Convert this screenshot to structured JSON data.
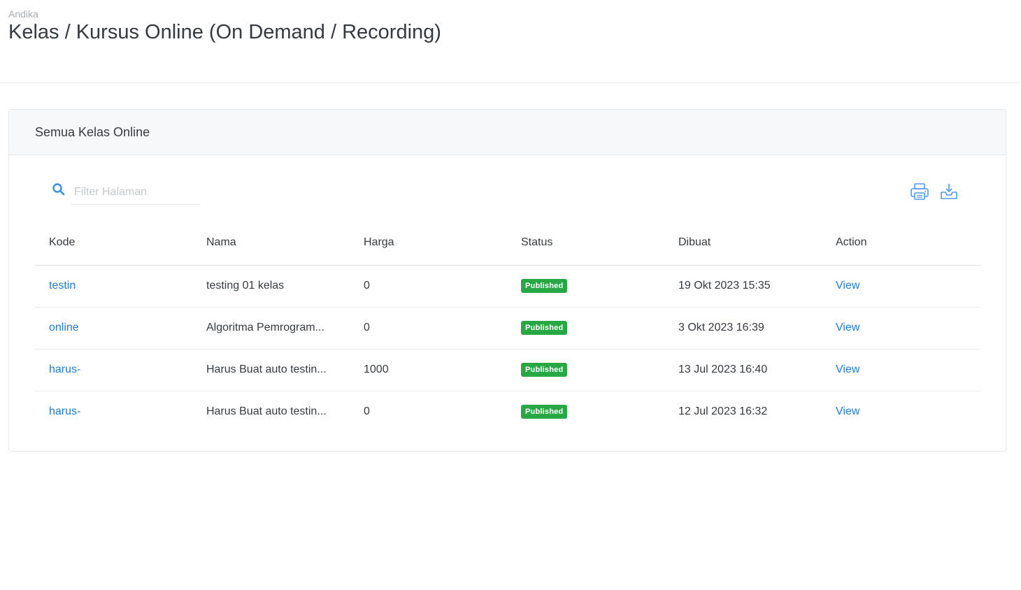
{
  "header": {
    "breadcrumb": "Andika",
    "title": "Kelas / Kursus Online (On Demand / Recording)"
  },
  "card": {
    "title": "Semua Kelas Online"
  },
  "toolbar": {
    "search_placeholder": "Filter Halaman",
    "search_value": "",
    "icons": [
      "search-icon",
      "print-icon",
      "export-icon"
    ]
  },
  "table": {
    "columns": [
      "Kode",
      "Nama",
      "Harga",
      "Status",
      "Dibuat",
      "Action"
    ],
    "rows": [
      {
        "kode": "testin",
        "nama": "testing 01 kelas",
        "harga": "0",
        "status": "Published",
        "dibuat": "19 Okt 2023 15:35",
        "action": "View"
      },
      {
        "kode": "online",
        "nama": "Algoritma Pemrogram...",
        "harga": "0",
        "status": "Published",
        "dibuat": "3 Okt 2023 16:39",
        "action": "View"
      },
      {
        "kode": "harus-",
        "nama": "Harus Buat auto testin...",
        "harga": "1000",
        "status": "Published",
        "dibuat": "13 Jul 2023 16:40",
        "action": "View"
      },
      {
        "kode": "harus-",
        "nama": "Harus Buat auto testin...",
        "harga": "0",
        "status": "Published",
        "dibuat": "12 Jul 2023 16:32",
        "action": "View"
      }
    ]
  },
  "colors": {
    "link": "#1f7ad6",
    "badge_published": "#28a745",
    "icon": "#4f97ea"
  }
}
